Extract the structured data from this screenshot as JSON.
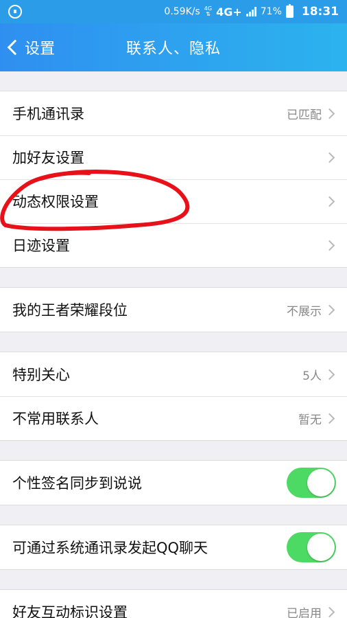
{
  "status_bar": {
    "network_speed": "0.59K/s",
    "network_small": "4G",
    "network_type": "4G+",
    "battery_percent": "71%",
    "time": "18:31"
  },
  "nav": {
    "back_label": "设置",
    "title": "联系人、隐私"
  },
  "groups": {
    "g1": {
      "contacts": {
        "label": "手机通讯录",
        "value": "已匹配"
      },
      "add_friend": {
        "label": "加好友设置",
        "value": ""
      },
      "feed_permission": {
        "label": "动态权限设置",
        "value": ""
      },
      "diary": {
        "label": "日迹设置",
        "value": ""
      }
    },
    "g2": {
      "king_rank": {
        "label": "我的王者荣耀段位",
        "value": "不展示"
      }
    },
    "g3": {
      "special_care": {
        "label": "特别关心",
        "value": "5人"
      },
      "infrequent": {
        "label": "不常用联系人",
        "value": "暂无"
      }
    },
    "g4": {
      "signature_sync": {
        "label": "个性签名同步到说说",
        "enabled": true
      }
    },
    "g5": {
      "qq_chat": {
        "label": "可通过系统通讯录发起QQ聊天",
        "enabled": true
      }
    },
    "g6": {
      "interaction_marks": {
        "label": "好友互动标识设置",
        "value": "已启用"
      }
    }
  },
  "colors": {
    "nav_start": "#2f8ff0",
    "nav_end": "#2cb3ee",
    "toggle_on": "#4cd964",
    "annotation": "#e8111a"
  }
}
